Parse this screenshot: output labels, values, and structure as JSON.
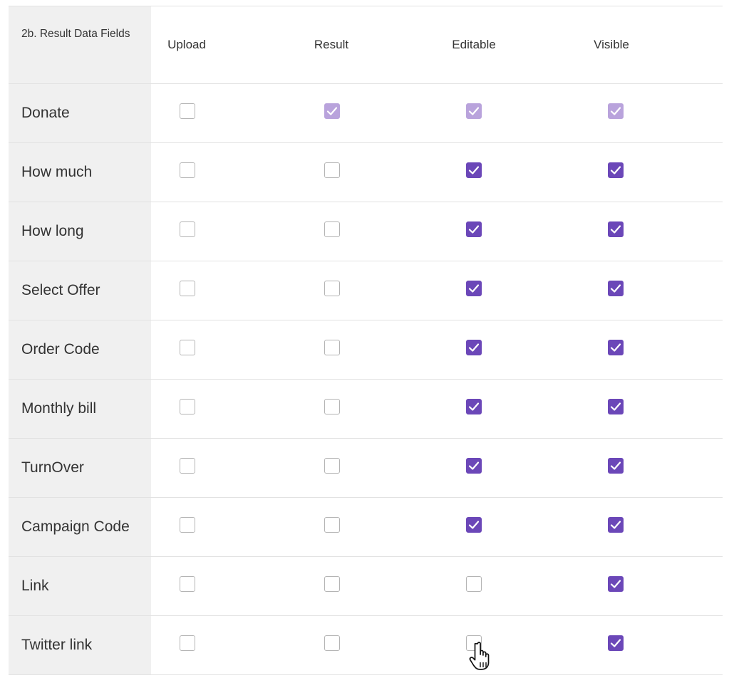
{
  "header": {
    "label": "2b. Result Data Fields",
    "columns": [
      "Upload",
      "Result",
      "Editable",
      "Visible"
    ]
  },
  "colors": {
    "checked": "#6b47b8",
    "checked_disabled": "#b9a3dc",
    "unchecked_border": "#b4b4b4",
    "label_bg": "#f0f0f0"
  },
  "rows": [
    {
      "label": "Donate",
      "states": [
        "unchecked",
        "checked-disabled",
        "checked-disabled",
        "checked-disabled"
      ]
    },
    {
      "label": "How much",
      "states": [
        "unchecked",
        "unchecked",
        "checked",
        "checked"
      ]
    },
    {
      "label": "How long",
      "states": [
        "unchecked",
        "unchecked",
        "checked",
        "checked"
      ]
    },
    {
      "label": "Select Offer",
      "states": [
        "unchecked",
        "unchecked",
        "checked",
        "checked"
      ]
    },
    {
      "label": "Order Code",
      "states": [
        "unchecked",
        "unchecked",
        "checked",
        "checked"
      ]
    },
    {
      "label": "Monthly bill",
      "states": [
        "unchecked",
        "unchecked",
        "checked",
        "checked"
      ]
    },
    {
      "label": "TurnOver",
      "states": [
        "unchecked",
        "unchecked",
        "checked",
        "checked"
      ]
    },
    {
      "label": "Campaign Code",
      "states": [
        "unchecked",
        "unchecked",
        "checked",
        "checked"
      ]
    },
    {
      "label": "Link",
      "states": [
        "unchecked",
        "unchecked",
        "unchecked",
        "checked"
      ]
    },
    {
      "label": "Twitter link",
      "states": [
        "unchecked",
        "unchecked",
        "unchecked",
        "checked"
      ]
    }
  ],
  "cursor": {
    "icon": "hand-pointer-icon"
  }
}
